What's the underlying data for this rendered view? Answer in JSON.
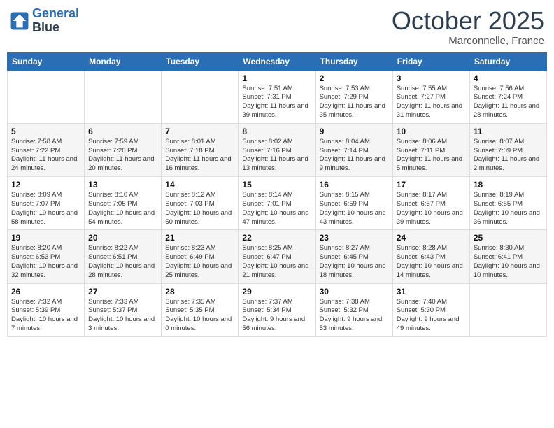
{
  "header": {
    "logo_line1": "General",
    "logo_line2": "Blue",
    "month": "October 2025",
    "location": "Marconnelle, France"
  },
  "weekdays": [
    "Sunday",
    "Monday",
    "Tuesday",
    "Wednesday",
    "Thursday",
    "Friday",
    "Saturday"
  ],
  "weeks": [
    [
      {
        "day": "",
        "info": ""
      },
      {
        "day": "",
        "info": ""
      },
      {
        "day": "",
        "info": ""
      },
      {
        "day": "1",
        "info": "Sunrise: 7:51 AM\nSunset: 7:31 PM\nDaylight: 11 hours and 39 minutes."
      },
      {
        "day": "2",
        "info": "Sunrise: 7:53 AM\nSunset: 7:29 PM\nDaylight: 11 hours and 35 minutes."
      },
      {
        "day": "3",
        "info": "Sunrise: 7:55 AM\nSunset: 7:27 PM\nDaylight: 11 hours and 31 minutes."
      },
      {
        "day": "4",
        "info": "Sunrise: 7:56 AM\nSunset: 7:24 PM\nDaylight: 11 hours and 28 minutes."
      }
    ],
    [
      {
        "day": "5",
        "info": "Sunrise: 7:58 AM\nSunset: 7:22 PM\nDaylight: 11 hours and 24 minutes."
      },
      {
        "day": "6",
        "info": "Sunrise: 7:59 AM\nSunset: 7:20 PM\nDaylight: 11 hours and 20 minutes."
      },
      {
        "day": "7",
        "info": "Sunrise: 8:01 AM\nSunset: 7:18 PM\nDaylight: 11 hours and 16 minutes."
      },
      {
        "day": "8",
        "info": "Sunrise: 8:02 AM\nSunset: 7:16 PM\nDaylight: 11 hours and 13 minutes."
      },
      {
        "day": "9",
        "info": "Sunrise: 8:04 AM\nSunset: 7:14 PM\nDaylight: 11 hours and 9 minutes."
      },
      {
        "day": "10",
        "info": "Sunrise: 8:06 AM\nSunset: 7:11 PM\nDaylight: 11 hours and 5 minutes."
      },
      {
        "day": "11",
        "info": "Sunrise: 8:07 AM\nSunset: 7:09 PM\nDaylight: 11 hours and 2 minutes."
      }
    ],
    [
      {
        "day": "12",
        "info": "Sunrise: 8:09 AM\nSunset: 7:07 PM\nDaylight: 10 hours and 58 minutes."
      },
      {
        "day": "13",
        "info": "Sunrise: 8:10 AM\nSunset: 7:05 PM\nDaylight: 10 hours and 54 minutes."
      },
      {
        "day": "14",
        "info": "Sunrise: 8:12 AM\nSunset: 7:03 PM\nDaylight: 10 hours and 50 minutes."
      },
      {
        "day": "15",
        "info": "Sunrise: 8:14 AM\nSunset: 7:01 PM\nDaylight: 10 hours and 47 minutes."
      },
      {
        "day": "16",
        "info": "Sunrise: 8:15 AM\nSunset: 6:59 PM\nDaylight: 10 hours and 43 minutes."
      },
      {
        "day": "17",
        "info": "Sunrise: 8:17 AM\nSunset: 6:57 PM\nDaylight: 10 hours and 39 minutes."
      },
      {
        "day": "18",
        "info": "Sunrise: 8:19 AM\nSunset: 6:55 PM\nDaylight: 10 hours and 36 minutes."
      }
    ],
    [
      {
        "day": "19",
        "info": "Sunrise: 8:20 AM\nSunset: 6:53 PM\nDaylight: 10 hours and 32 minutes."
      },
      {
        "day": "20",
        "info": "Sunrise: 8:22 AM\nSunset: 6:51 PM\nDaylight: 10 hours and 28 minutes."
      },
      {
        "day": "21",
        "info": "Sunrise: 8:23 AM\nSunset: 6:49 PM\nDaylight: 10 hours and 25 minutes."
      },
      {
        "day": "22",
        "info": "Sunrise: 8:25 AM\nSunset: 6:47 PM\nDaylight: 10 hours and 21 minutes."
      },
      {
        "day": "23",
        "info": "Sunrise: 8:27 AM\nSunset: 6:45 PM\nDaylight: 10 hours and 18 minutes."
      },
      {
        "day": "24",
        "info": "Sunrise: 8:28 AM\nSunset: 6:43 PM\nDaylight: 10 hours and 14 minutes."
      },
      {
        "day": "25",
        "info": "Sunrise: 8:30 AM\nSunset: 6:41 PM\nDaylight: 10 hours and 10 minutes."
      }
    ],
    [
      {
        "day": "26",
        "info": "Sunrise: 7:32 AM\nSunset: 5:39 PM\nDaylight: 10 hours and 7 minutes."
      },
      {
        "day": "27",
        "info": "Sunrise: 7:33 AM\nSunset: 5:37 PM\nDaylight: 10 hours and 3 minutes."
      },
      {
        "day": "28",
        "info": "Sunrise: 7:35 AM\nSunset: 5:35 PM\nDaylight: 10 hours and 0 minutes."
      },
      {
        "day": "29",
        "info": "Sunrise: 7:37 AM\nSunset: 5:34 PM\nDaylight: 9 hours and 56 minutes."
      },
      {
        "day": "30",
        "info": "Sunrise: 7:38 AM\nSunset: 5:32 PM\nDaylight: 9 hours and 53 minutes."
      },
      {
        "day": "31",
        "info": "Sunrise: 7:40 AM\nSunset: 5:30 PM\nDaylight: 9 hours and 49 minutes."
      },
      {
        "day": "",
        "info": ""
      }
    ]
  ]
}
